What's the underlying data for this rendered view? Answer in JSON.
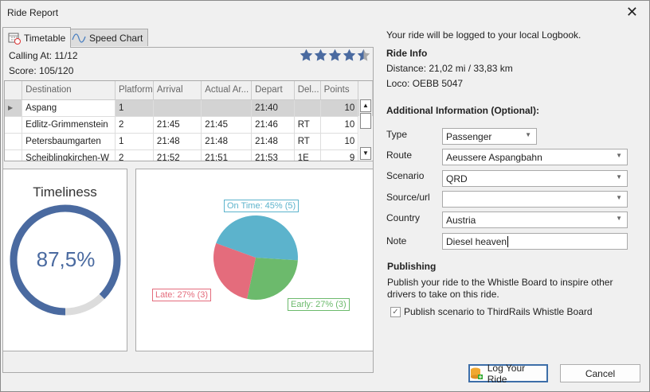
{
  "window": {
    "title": "Ride Report",
    "close": "✕"
  },
  "tabs": [
    {
      "label": "Timetable"
    },
    {
      "label": "Speed Chart"
    }
  ],
  "summary": {
    "calling_at": "Calling At: 11/12",
    "score": "Score: 105/120",
    "rating": 4.5,
    "rating_max": 5
  },
  "table": {
    "columns": [
      "Destination",
      "Platform",
      "Arrival",
      "Actual Ar...",
      "Depart",
      "Del...",
      "Points"
    ],
    "rows": [
      [
        "Aspang",
        "1",
        "",
        "",
        "21:40",
        "",
        "10"
      ],
      [
        "Edlitz-Grimmenstein",
        "2",
        "21:45",
        "21:45",
        "21:46",
        "RT",
        "10"
      ],
      [
        "Petersbaumgarten",
        "1",
        "21:48",
        "21:48",
        "21:48",
        "RT",
        "10"
      ],
      [
        "Scheiblingkirchen-W",
        "2",
        "21:52",
        "21:51",
        "21:53",
        "1E",
        "9"
      ]
    ]
  },
  "timeliness": {
    "title": "Timeliness",
    "value_label": "87,5%",
    "value": 87.5,
    "color": "#4a6aa0"
  },
  "pie": {
    "slices": [
      {
        "name": "On Time",
        "label": "On Time: 45% (5)",
        "pct": 45,
        "color": "#5cb3cc"
      },
      {
        "name": "Early",
        "label": "Early: 27% (3)",
        "pct": 27,
        "color": "#6cba6c"
      },
      {
        "name": "Late",
        "label": "Late: 27% (3)",
        "pct": 27,
        "color": "#e46c7c"
      }
    ]
  },
  "right": {
    "logged": "Your ride will be logged to your local Logbook.",
    "ride_info": "Ride Info",
    "distance": "Distance: 21,02 mi / 33,83 km",
    "loco": "Loco: OEBB 5047",
    "additional": "Additional Information (Optional):",
    "fields": [
      {
        "label": "Type",
        "value": ""
      },
      {
        "label": "Route",
        "value": ""
      },
      {
        "label": "Scenario",
        "value": ""
      },
      {
        "label": "Source/url",
        "value": ""
      },
      {
        "label": "Country",
        "value": ""
      },
      {
        "label": "Note",
        "value": ""
      }
    ],
    "type": "Passenger",
    "route": "Aeussere Aspangbahn",
    "scenario": "QRD",
    "source": "",
    "country": "Austria",
    "note": "Diesel heaven",
    "publishing": "Publishing",
    "publish_text": "Publish your ride to the Whistle Board to inspire other drivers to take on this ride.",
    "publish_check": "Publish scenario to ThirdRails Whistle Board",
    "publish_checked": true
  },
  "buttons": {
    "log": "Log Your Ride",
    "cancel": "Cancel"
  }
}
